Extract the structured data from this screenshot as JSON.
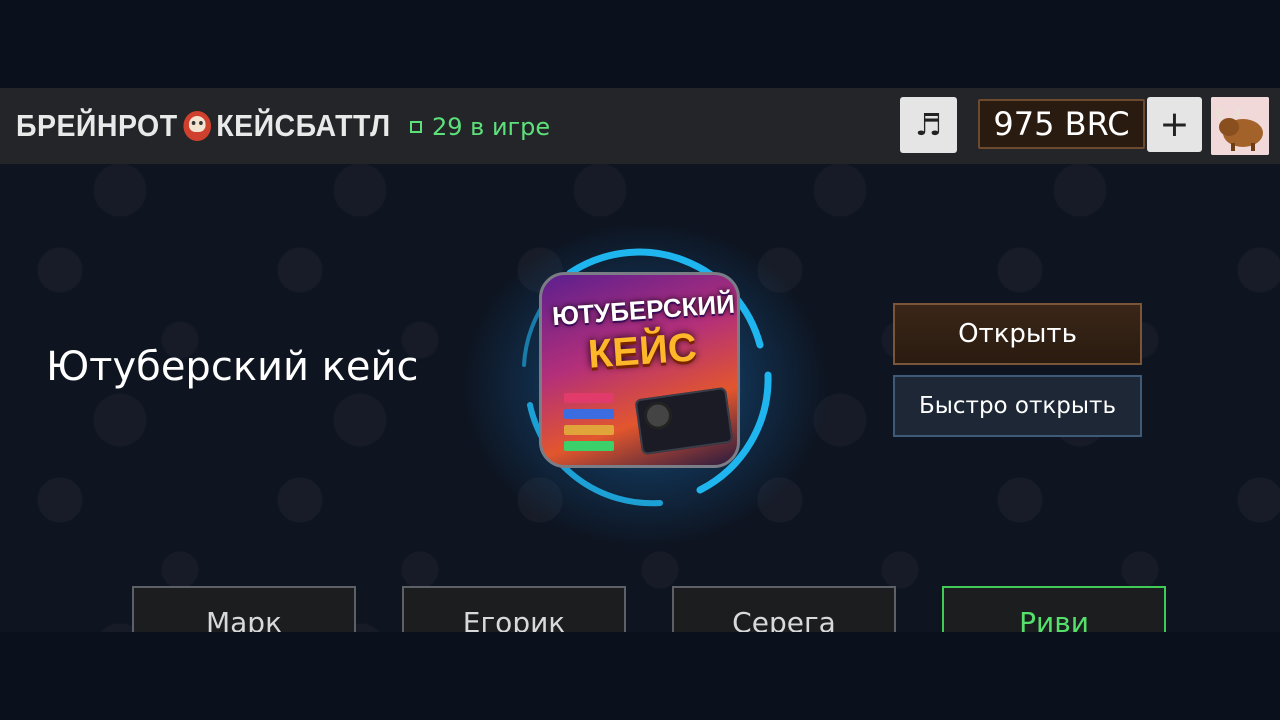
{
  "header": {
    "brand_left": "БРЕЙНРОТ",
    "brand_right": "КЕЙСБАТТЛ",
    "online_text": "29 в игре",
    "music_icon": "♬",
    "balance": "975 BRC",
    "plus_label": "+"
  },
  "case": {
    "title": "Ютуберский кейс",
    "image_line1": "ЮТУБЕРСКИЙ",
    "image_line2": "КЕЙС",
    "open_label": "Открыть",
    "fast_open_label": "Быстро открыть"
  },
  "players": [
    {
      "name": "Марк",
      "active": false
    },
    {
      "name": "Егорик",
      "active": false
    },
    {
      "name": "Серега",
      "active": false
    },
    {
      "name": "Риви",
      "active": true
    }
  ],
  "colors": {
    "accent_green": "#55e06b",
    "open_button": "#2a1b10",
    "fast_button": "#1d2735",
    "glow": "#18a0e6"
  }
}
